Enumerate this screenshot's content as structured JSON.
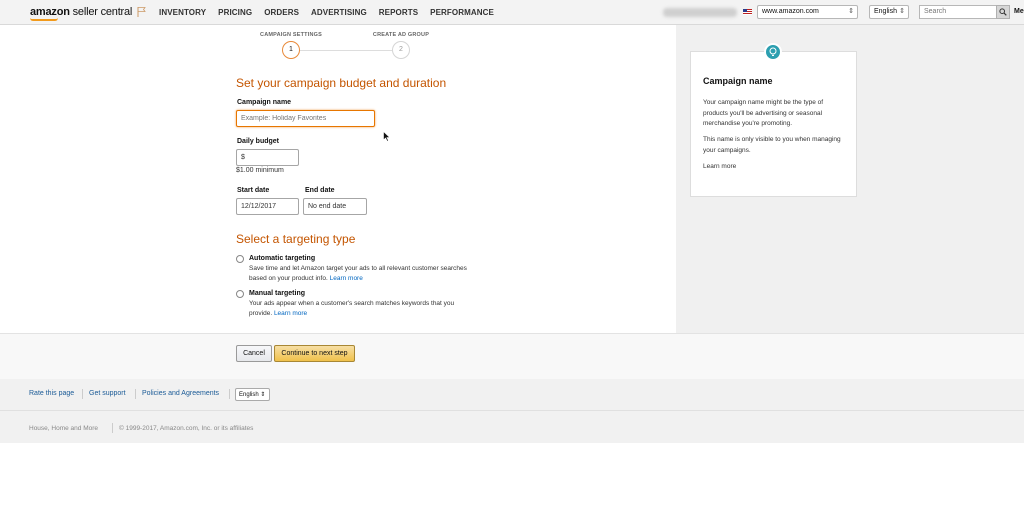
{
  "header": {
    "logo_brand": "amazon",
    "logo_sub": " seller central",
    "nav": [
      "INVENTORY",
      "PRICING",
      "ORDERS",
      "ADVERTISING",
      "REPORTS",
      "PERFORMANCE"
    ],
    "marketplace": "www.amazon.com",
    "language": "English",
    "search_placeholder": "Search",
    "more_label": "Me"
  },
  "stepper": {
    "steps": [
      {
        "label": "CAMPAIGN SETTINGS",
        "number": "1",
        "active": true
      },
      {
        "label": "CREATE AD GROUP",
        "number": "2",
        "active": false
      }
    ]
  },
  "form": {
    "section_budget_title": "Set your campaign budget and duration",
    "campaign_name_label": "Campaign name",
    "campaign_name_placeholder": "Example: Holiday Favorites",
    "daily_budget_label": "Daily budget",
    "daily_budget_prefix": "$",
    "daily_budget_hint": "$1.00 minimum",
    "start_date_label": "Start date",
    "start_date_value": "12/12/2017",
    "end_date_label": "End date",
    "end_date_value": "No end date",
    "section_targeting_title": "Select a targeting type",
    "targeting_options": [
      {
        "title": "Automatic targeting",
        "desc": "Save time and let Amazon target your ads to all relevant customer searches based on your product info.",
        "link": "Learn more"
      },
      {
        "title": "Manual targeting",
        "desc": "Your ads appear when a customer's search matches keywords that you provide.",
        "link": "Learn more"
      }
    ]
  },
  "help_panel": {
    "title": "Campaign name",
    "paragraph1": "Your campaign name might be the type of products you'll be advertising or seasonal merchandise you're promoting.",
    "paragraph2": "This name is only visible to you when managing your campaigns.",
    "link": "Learn more",
    "icon": "lightbulb-icon",
    "icon_color": "#2c9fb0"
  },
  "actions": {
    "cancel_label": "Cancel",
    "continue_label": "Continue to next step"
  },
  "footer": {
    "links": [
      "Rate this page",
      "Get support",
      "Policies and Agreements"
    ],
    "language": "English",
    "category": "House, Home and More",
    "copyright": "© 1999-2017, Amazon.com, Inc. or its affiliates"
  },
  "colors": {
    "accent_orange": "#c45500",
    "link_blue": "#0066c0",
    "button_yellow": "#f0c14b"
  }
}
